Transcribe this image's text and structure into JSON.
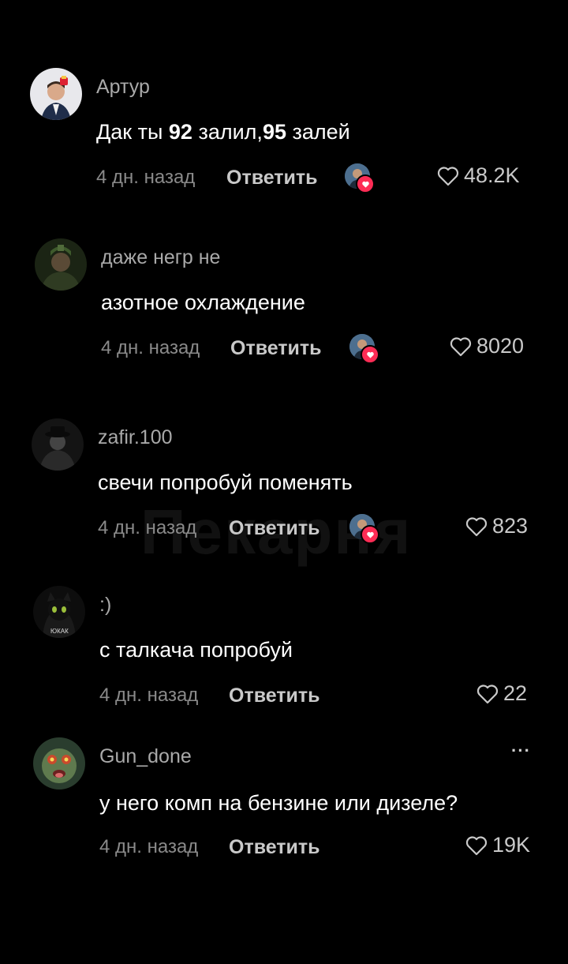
{
  "watermark": "Пекарня",
  "comments": [
    {
      "author": "Артур",
      "text_parts": [
        "Дак ты ",
        "92",
        " залил,",
        "95",
        " залей"
      ],
      "time": "4 дн. назад",
      "reply": "Ответить",
      "likes": "48.2K"
    },
    {
      "author": "даже негр не",
      "text": "азотное охлаждение",
      "time": "4 дн. назад",
      "reply": "Ответить",
      "likes": "8020"
    },
    {
      "author": "zafir.100",
      "text": "свечи попробуй поменять",
      "time": "4 дн. назад",
      "reply": "Ответить",
      "likes": "823"
    },
    {
      "author": ":)",
      "text": "с талкача попробуй",
      "time": "4 дн. назад",
      "reply": "Ответить",
      "likes": "22"
    },
    {
      "author": "Gun_done",
      "text": "у него комп на бензине или дизеле?",
      "time": "4 дн. назад",
      "reply": "Ответить",
      "likes": "19K",
      "more": "···"
    }
  ],
  "colors": {
    "background": "#000000",
    "heart_badge": "#fe2c55"
  }
}
